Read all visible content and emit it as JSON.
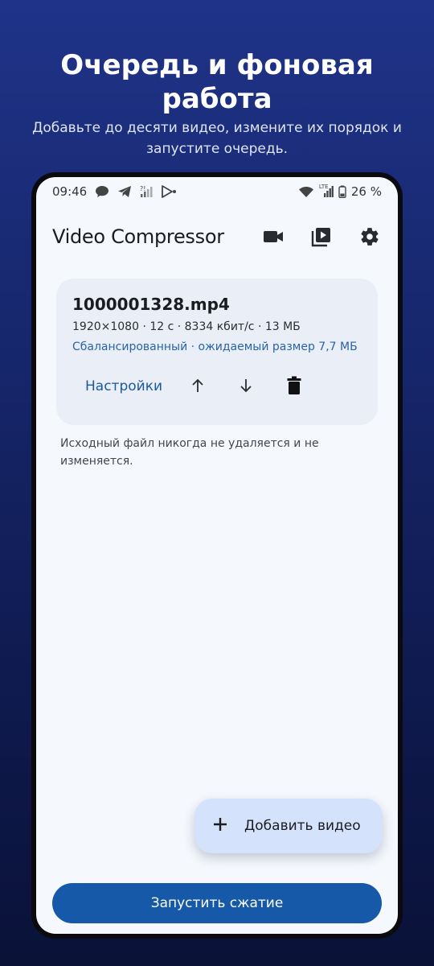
{
  "promo": {
    "title_line1": "Очередь и фоновая",
    "title_line2": "работа",
    "subtitle_line1": "Добавьте до десяти видео, измените их порядок и",
    "subtitle_line2": "запустите очередь."
  },
  "status_bar": {
    "time": "09:46",
    "battery": "26 %",
    "network_label": "LTE"
  },
  "app_bar": {
    "title": "Video Compressor",
    "actions": [
      "videocam-icon",
      "video-library-icon",
      "settings-gear-icon"
    ]
  },
  "queue": [
    {
      "file_name": "1000001328.mp4",
      "meta": "1920×1080 · 12 с · 8334 кбит/с · 13 МБ",
      "preset": "Сбалансированный · ожидаемый размер 7,7 МБ",
      "settings_label": "Настройки"
    }
  ],
  "note_line1": "Исходный файл никогда не удаляется и не",
  "note_line2": "изменяется.",
  "fab_label": "Добавить видео",
  "start_label": "Запустить сжатие",
  "colors": {
    "accent": "#1559a8",
    "card_bg": "#e9eef7",
    "fab_bg": "#d5e2fb",
    "screen_bg": "#f5f8fd"
  }
}
